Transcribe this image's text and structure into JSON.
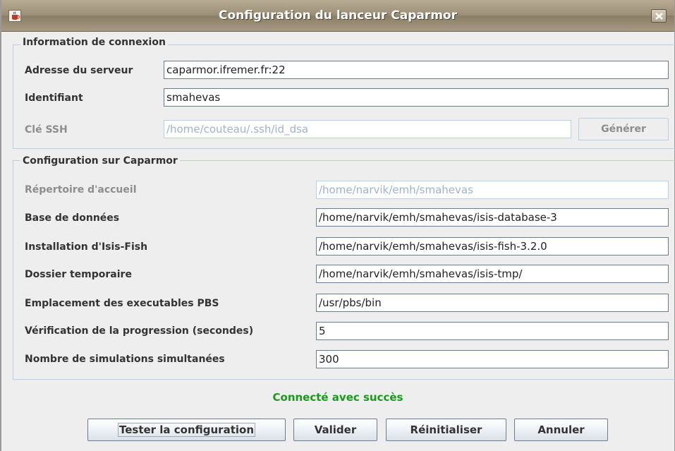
{
  "window": {
    "title": "Configuration du lanceur Caparmor",
    "icon": "java-coffee-cup-icon",
    "close_icon": "close-icon"
  },
  "connexion": {
    "title": "Information de connexion",
    "server": {
      "label": "Adresse du serveur",
      "value": "caparmor.ifremer.fr:22"
    },
    "login": {
      "label": "Identifiant",
      "value": "smahevas"
    },
    "ssh": {
      "label": "Clé SSH",
      "value": "/home/couteau/.ssh/id_dsa",
      "enabled": false
    },
    "generate_button": "Générer"
  },
  "caparmor": {
    "title": "Configuration sur Caparmor",
    "home": {
      "label": "Répertoire d'accueil",
      "value": "/home/narvik/emh/smahevas",
      "enabled": false
    },
    "database": {
      "label": "Base de données",
      "value": "/home/narvik/emh/smahevas/isis-database-3"
    },
    "install": {
      "label": "Installation d'Isis-Fish",
      "value": "/home/narvik/emh/smahevas/isis-fish-3.2.0"
    },
    "temp": {
      "label": "Dossier temporaire",
      "value": "/home/narvik/emh/smahevas/isis-tmp/"
    },
    "pbs": {
      "label": "Emplacement des executables PBS",
      "value": "/usr/pbs/bin"
    },
    "check": {
      "label": "Vérification de la progression (secondes)",
      "value": "5"
    },
    "simulations": {
      "label": "Nombre de simulations simultanées",
      "value": "300"
    }
  },
  "status": {
    "text": "Connecté avec succès",
    "color": "#1a9a1a"
  },
  "buttons": {
    "test": "Tester la configuration",
    "validate": "Valider",
    "reset": "Réinitialiser",
    "cancel": "Annuler"
  }
}
